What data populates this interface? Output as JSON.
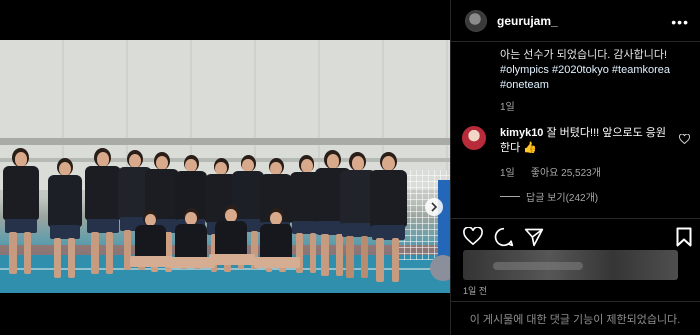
{
  "header": {
    "username": "geurujam_",
    "more_label": "•••"
  },
  "caption": {
    "text_top": "아는 선수가 되었습니다. 감사합니다!",
    "tags": [
      "#olympics",
      "#2020tokyo",
      "#teamkorea",
      "#oneteam"
    ],
    "time": "1일"
  },
  "comment": {
    "username": "kimyk10",
    "text": "잘 버텼다!!! 앞으로도 응원한다 👍",
    "time": "1일",
    "likes": "좋아요 25,523개",
    "replies": "답글 보기(242개)"
  },
  "post": {
    "time": "1일 전",
    "footer": "이 게시물에 대한 댓글 기능이 제한되었습니다."
  },
  "media": {
    "slide_count": 6,
    "active_slide": 1
  },
  "icons": {
    "like": "heart-icon",
    "comment": "comment-icon",
    "share": "paper-plane-icon",
    "save": "bookmark-icon",
    "mute": "speaker-muted-icon",
    "next": "chevron-right-icon"
  }
}
